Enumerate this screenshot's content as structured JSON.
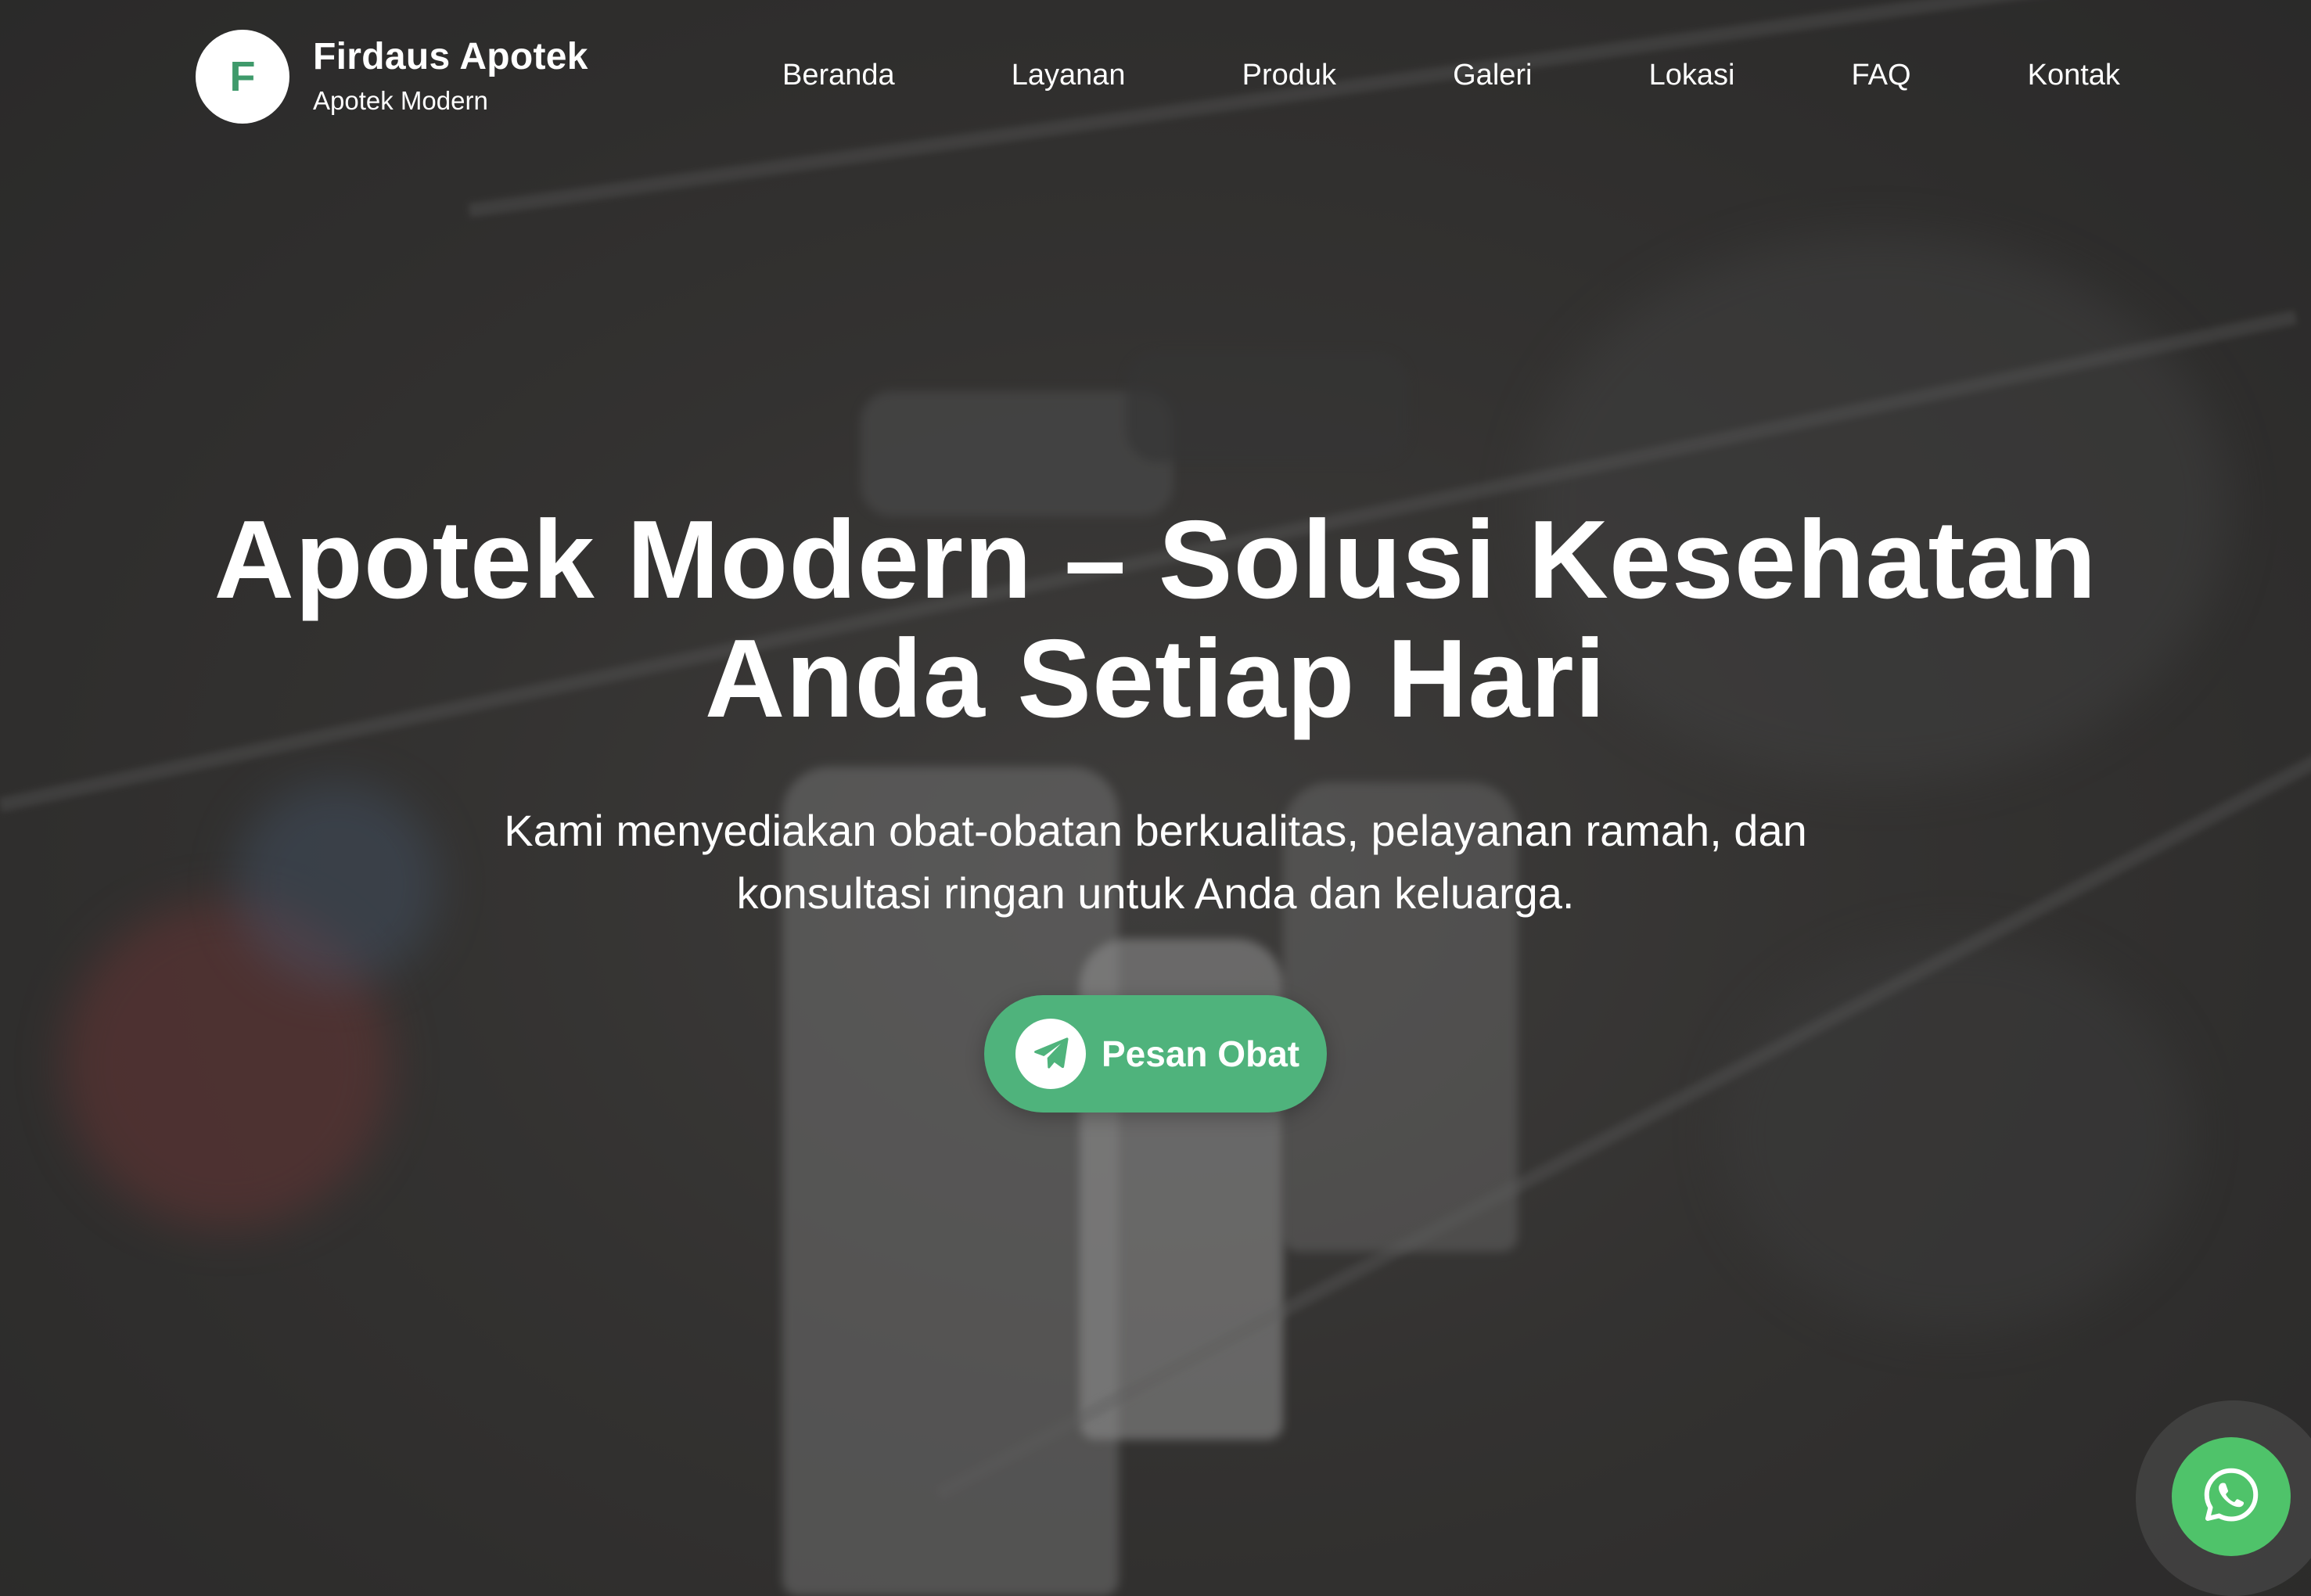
{
  "brand": {
    "logo_letter": "F",
    "name": "Firdaus Apotek",
    "tagline": "Apotek Modern"
  },
  "nav": {
    "items": [
      {
        "label": "Beranda"
      },
      {
        "label": "Layanan"
      },
      {
        "label": "Produk"
      },
      {
        "label": "Galeri"
      },
      {
        "label": "Lokasi"
      },
      {
        "label": "FAQ"
      },
      {
        "label": "Kontak"
      }
    ]
  },
  "hero": {
    "title_line1": "Apotek Modern – Solusi Kesehatan",
    "title_line2": "Anda Setiap Hari",
    "subtitle_line1": "Kami menyediakan obat-obatan berkualitas, pelayanan ramah, dan",
    "subtitle_line2": "konsultasi ringan untuk Anda dan keluarga.",
    "cta_label": "Pesan Obat",
    "cta_icon": "paper-plane-icon"
  },
  "floating": {
    "whatsapp_icon": "whatsapp-icon"
  },
  "colors": {
    "accent": "#4fb37c",
    "logo_text": "#3f9a6b",
    "whatsapp": "#4fc36a",
    "text": "#ffffff"
  }
}
